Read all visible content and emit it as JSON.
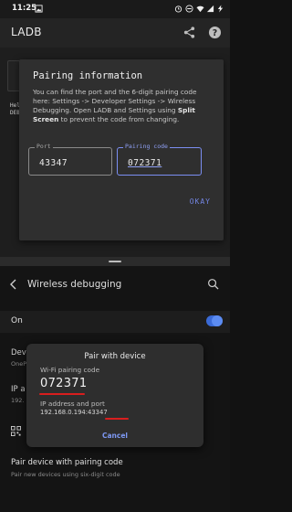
{
  "status_bar": {
    "time": "11:25"
  },
  "app": {
    "title": "LADB"
  },
  "background_text": [
    "Hel",
    "DEB"
  ],
  "pairing_dialog": {
    "title": "Pairing information",
    "body_prefix": "You can find the port and the 6-digit pairing code here: Settings -> Developer Settings -> Wireless Debugging. Open LADB and Settings using ",
    "body_bold": "Split Screen",
    "body_suffix": " to prevent the code from changing.",
    "port_label": "Port",
    "port_value": "43347",
    "code_label": "Pairing code",
    "code_value": "072371",
    "okay_label": "OKAY"
  },
  "settings": {
    "title": "Wireless debugging",
    "on_label": "On",
    "device_name_label": "Devi",
    "device_name_sub": "OneP",
    "ip_label": "IP a",
    "ip_sub": "192.",
    "pair_code_title": "Pair device with pairing code",
    "pair_code_sub": "Pair new devices using six-digit code",
    "toggle_on": true
  },
  "pair_device_dialog": {
    "title": "Pair with device",
    "wifi_code_label": "Wi-Fi pairing code",
    "wifi_code": "072371",
    "ip_label": "IP address and port",
    "ip_value": "192.168.0.194:43347",
    "cancel_label": "Cancel"
  },
  "colors": {
    "accent": "#7b8ef2",
    "annotation": "#d81e1e",
    "toggle": "#5c8cf2"
  },
  "icons": [
    "image-icon",
    "alarm-icon",
    "dnd-icon",
    "wifi-icon",
    "signal-icon",
    "battery-icon",
    "share-icon",
    "help-icon",
    "back-arrow-icon",
    "search-icon",
    "qr-code-icon"
  ]
}
